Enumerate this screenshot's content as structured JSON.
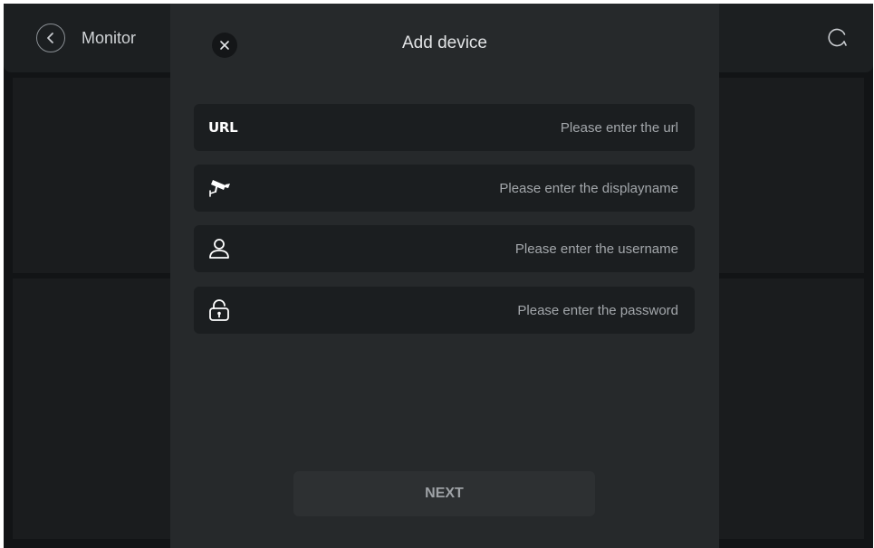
{
  "header": {
    "back_icon": "chevron-left-icon",
    "title": "Monitor",
    "refresh_icon": "refresh-icon"
  },
  "dialog": {
    "close_icon": "close-icon",
    "title": "Add device",
    "fields": [
      {
        "name": "url",
        "icon": "URL",
        "placeholder": "Please enter the url",
        "value": ""
      },
      {
        "name": "displayname",
        "icon": "camera-icon",
        "placeholder": "Please enter the displayname",
        "value": ""
      },
      {
        "name": "username",
        "icon": "user-icon",
        "placeholder": "Please enter the username",
        "value": ""
      },
      {
        "name": "password",
        "icon": "lock-icon",
        "placeholder": "Please enter the password",
        "value": ""
      }
    ],
    "next_label": "NEXT"
  },
  "colors": {
    "background": "#121416",
    "modal": "#26292b",
    "field": "#1b1e20",
    "button": "#2d3032",
    "text": "#e2e4e6",
    "placeholder": "#a3a7ab"
  }
}
